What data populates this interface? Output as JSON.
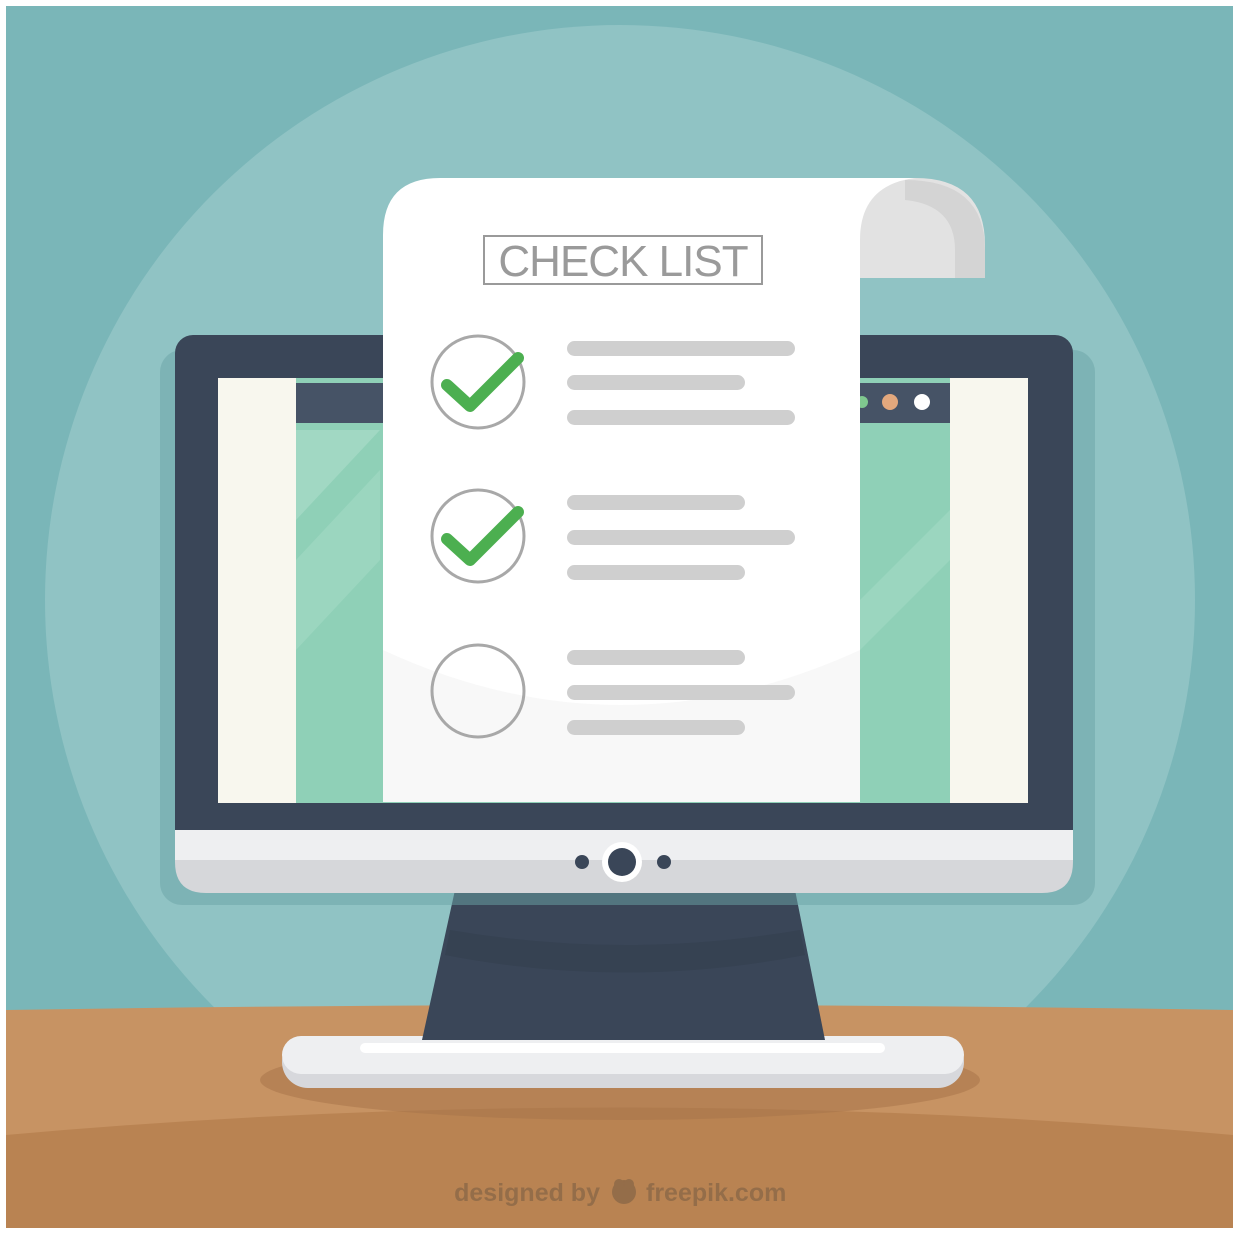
{
  "checklist": {
    "title": "CHECK LIST",
    "items": [
      {
        "checked": true
      },
      {
        "checked": true
      },
      {
        "checked": false
      }
    ]
  },
  "credit": {
    "designed_by": "designed by",
    "brand": "freepik.com"
  },
  "colors": {
    "background": "#7ab6b8",
    "halo": "#90c3c4",
    "desk": "#c08b5b",
    "monitor_frame": "#3a4658",
    "screen_green": "#8fd0b7",
    "check_green": "#4caf50",
    "paper": "#ffffff",
    "line_gray": "#cfcfcf"
  },
  "icons": [
    "checkmark-icon",
    "empty-circle-icon",
    "webcam-icon",
    "freepik-logo-icon"
  ]
}
